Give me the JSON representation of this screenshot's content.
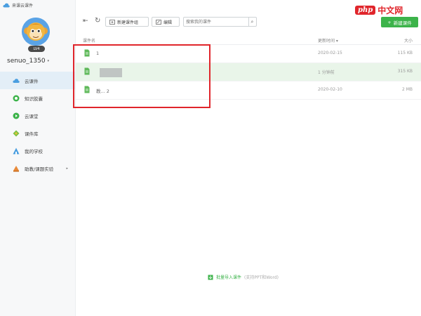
{
  "app": {
    "title": "来课云课件"
  },
  "user": {
    "name": "senuo_1350",
    "badge": "LV4"
  },
  "sidebar": {
    "items": [
      {
        "label": "云课件",
        "icon": "cloud-icon",
        "active": true
      },
      {
        "label": "知识胶囊",
        "icon": "capsule-icon",
        "active": false
      },
      {
        "label": "云课堂",
        "icon": "classroom-icon",
        "active": false
      },
      {
        "label": "课件库",
        "icon": "library-icon",
        "active": false
      },
      {
        "label": "我的学校",
        "icon": "school-icon",
        "active": false
      },
      {
        "label": "助教/课题实验",
        "icon": "research-icon",
        "active": false,
        "more": "▸"
      }
    ]
  },
  "toolbar": {
    "back_icon": "⇤",
    "refresh_icon": "↻",
    "new_folder_label": "新建课件组",
    "edit_label": "编辑",
    "search_placeholder": "搜索我的课件",
    "new_file_label": "新建课件"
  },
  "table": {
    "headers": {
      "name": "课件名",
      "date": "更新时间 ▾",
      "size": "大小"
    },
    "rows": [
      {
        "name": "1",
        "date": "2020-02-15",
        "size": "115 KB",
        "selected": false
      },
      {
        "name": "",
        "date": "1 分钟前",
        "size": "315 KB",
        "selected": true
      },
      {
        "name": "教...                    2",
        "date": "2020-02-10",
        "size": "2 MB",
        "selected": false
      }
    ]
  },
  "footer": {
    "import_label": "批量导入课件",
    "import_hint": "(支持PPT和Word)"
  },
  "watermark": {
    "logo": "php",
    "text": "中文网"
  },
  "colors": {
    "accent": "#3cb34a",
    "highlight": "#e0252b",
    "nav_active": "#e3eef7"
  }
}
